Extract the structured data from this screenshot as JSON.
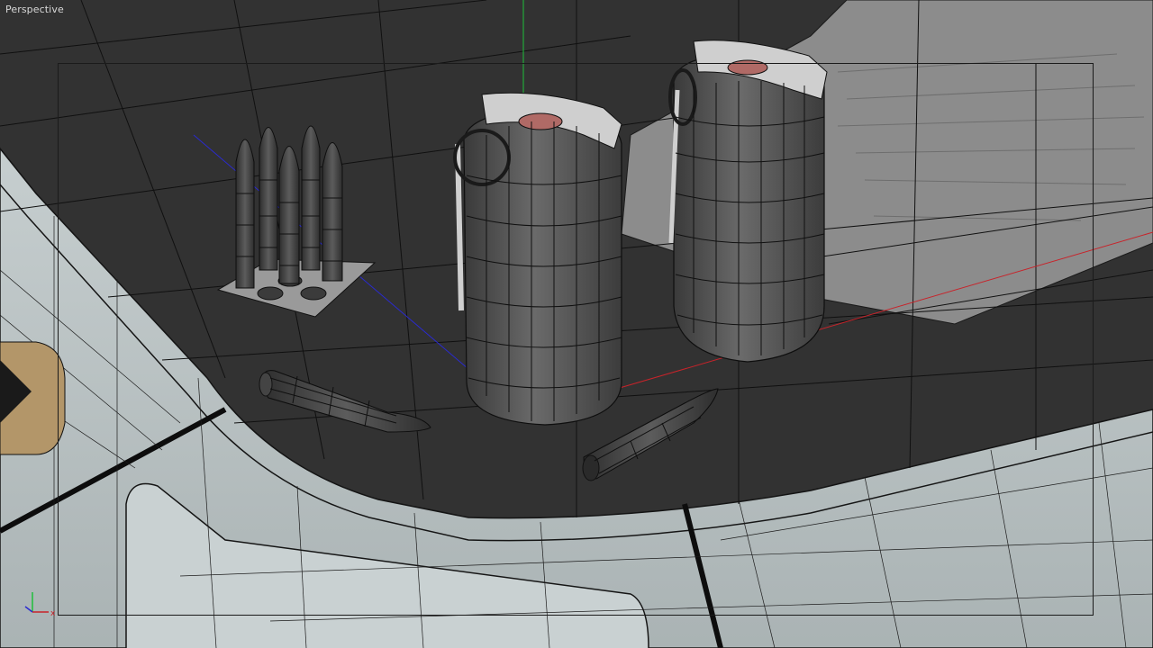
{
  "viewport": {
    "label": "Perspective",
    "view_type": "perspective",
    "shading": "wireframe-over-shaded"
  },
  "colors": {
    "background": "#3a3a3a",
    "floor_dark": "#2f2f2f",
    "floor_light": "#b9c2c3",
    "paper": "#8f8f8f",
    "mesh_gray": "#5a5a5a",
    "wire": "#101010",
    "axis_x": "#c8232a",
    "axis_y": "#1fbf3a",
    "axis_z": "#2a2ad0",
    "accent_tan": "#b89a6e",
    "fuse_cap": "#b06a66"
  },
  "scene_objects": [
    {
      "name": "bullet-clip",
      "kind": "ammunition-stack",
      "count": 5
    },
    {
      "name": "grenade-front",
      "kind": "grenade"
    },
    {
      "name": "grenade-back",
      "kind": "grenade"
    },
    {
      "name": "bullet-loose-left",
      "kind": "bullet"
    },
    {
      "name": "bullet-loose-right",
      "kind": "bullet"
    },
    {
      "name": "paper-sheet",
      "kind": "plane"
    }
  ],
  "gizmo": {
    "x_label": "x",
    "axes": [
      "x",
      "y",
      "z"
    ]
  }
}
